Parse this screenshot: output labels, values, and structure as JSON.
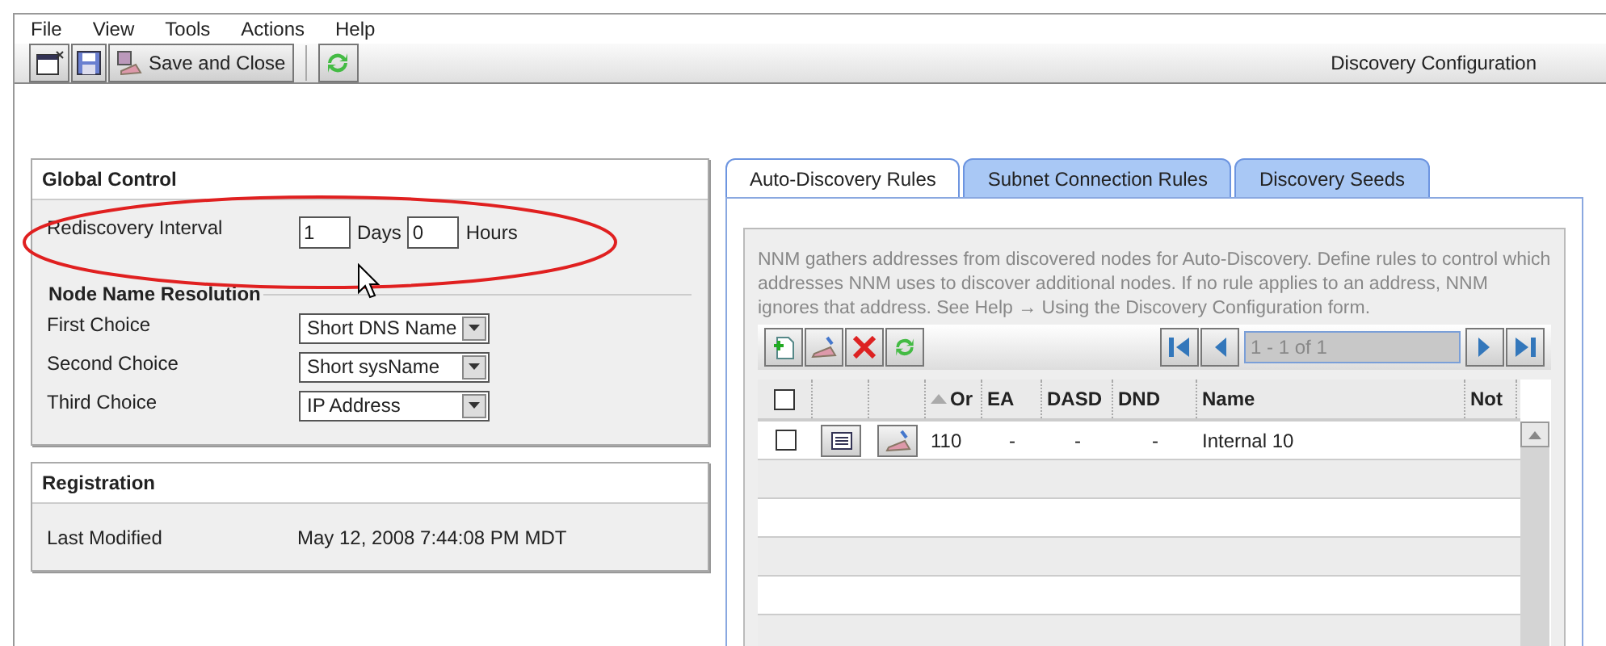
{
  "menu": [
    "File",
    "View",
    "Tools",
    "Actions",
    "Help"
  ],
  "toolbar": {
    "save_close": "Save and Close",
    "title": "Discovery Configuration"
  },
  "global_control": {
    "title": "Global Control",
    "interval_label": "Rediscovery Interval",
    "days_value": "1",
    "days_label": "Days",
    "hours_value": "0",
    "hours_label": "Hours",
    "section": "Node Name Resolution",
    "choices": [
      {
        "label": "First Choice",
        "value": "Short DNS Name"
      },
      {
        "label": "Second Choice",
        "value": "Short sysName"
      },
      {
        "label": "Third Choice",
        "value": "IP Address"
      }
    ]
  },
  "registration": {
    "title": "Registration",
    "label": "Last Modified",
    "value": "May 12, 2008 7:44:08 PM MDT"
  },
  "tabs": [
    {
      "label": "Auto-Discovery Rules",
      "selected": true
    },
    {
      "label": "Subnet Connection Rules",
      "selected": false
    },
    {
      "label": "Discovery Seeds",
      "selected": false
    }
  ],
  "description": "NNM gathers addresses from discovered nodes for Auto-Discovery. Define rules to control which addresses NNM uses to discover additional nodes. If no rule applies to an address, NNM ignores that address. See Help → Using the Discovery Configuration form.",
  "pager": "1 - 1 of 1",
  "table": {
    "header_checked": false,
    "columns": [
      {
        "label": "Or",
        "sorted": true
      },
      {
        "label": "EA",
        "sorted": false
      },
      {
        "label": "DASD",
        "sorted": false
      },
      {
        "label": "DND",
        "sorted": false
      },
      {
        "label": "Name",
        "sorted": false
      },
      {
        "label": "Not",
        "sorted": false
      }
    ],
    "rows": [
      {
        "checked": false,
        "cells": [
          "110",
          "-",
          "-",
          "-",
          "Internal 10"
        ]
      }
    ]
  }
}
